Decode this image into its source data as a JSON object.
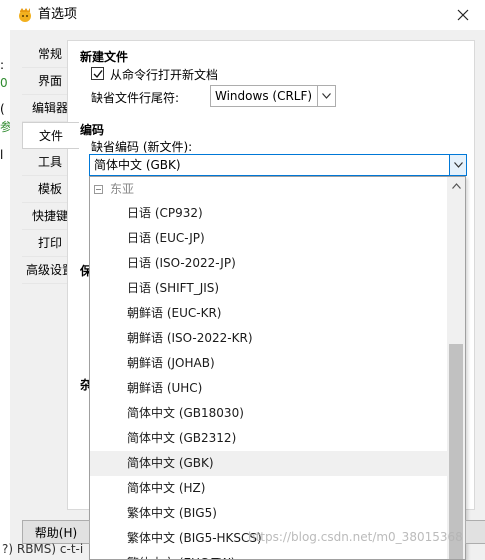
{
  "window": {
    "title": "首选项"
  },
  "background": {
    "left_chars": [
      ":",
      "0",
      "(",
      "参",
      "l"
    ],
    "bottom_text": "?) RBMS) c-t-i"
  },
  "nav": {
    "items": [
      "常规",
      "界面",
      "编辑器",
      "文件",
      "工具",
      "模板",
      "快捷键",
      "打印",
      "高级设置"
    ],
    "active_index": 3
  },
  "new_file": {
    "heading": "新建文件",
    "open_from_cmdline_label": "从命令行打开新文档",
    "open_from_cmdline_checked": true,
    "eol_label": "缺省文件行尾符:",
    "eol_value": "Windows (CRLF)"
  },
  "encoding": {
    "heading": "编码",
    "default_label": "缺省编码 (新文件):",
    "default_value": "简体中文 (GBK)"
  },
  "hidden_labels": [
    "保",
    "杂"
  ],
  "dropdown": {
    "group": "东亚",
    "items": [
      "日语 (CP932)",
      "日语 (EUC-JP)",
      "日语 (ISO-2022-JP)",
      "日语 (SHIFT_JIS)",
      "朝鲜语 (EUC-KR)",
      "朝鲜语 (ISO-2022-KR)",
      "朝鲜语 (JOHAB)",
      "朝鲜语 (UHC)",
      "简体中文 (GB18030)",
      "简体中文 (GB2312)",
      "简体中文 (GBK)",
      "简体中文 (HZ)",
      "繁体中文 (BIG5)",
      "繁体中文 (BIG5-HKSCS)",
      "繁体中文 (EUC-TW)"
    ],
    "selected_index": 10
  },
  "buttons": {
    "help_label": "帮助(H)"
  },
  "watermark": "https://blog.csdn.net/m0_38015368"
}
